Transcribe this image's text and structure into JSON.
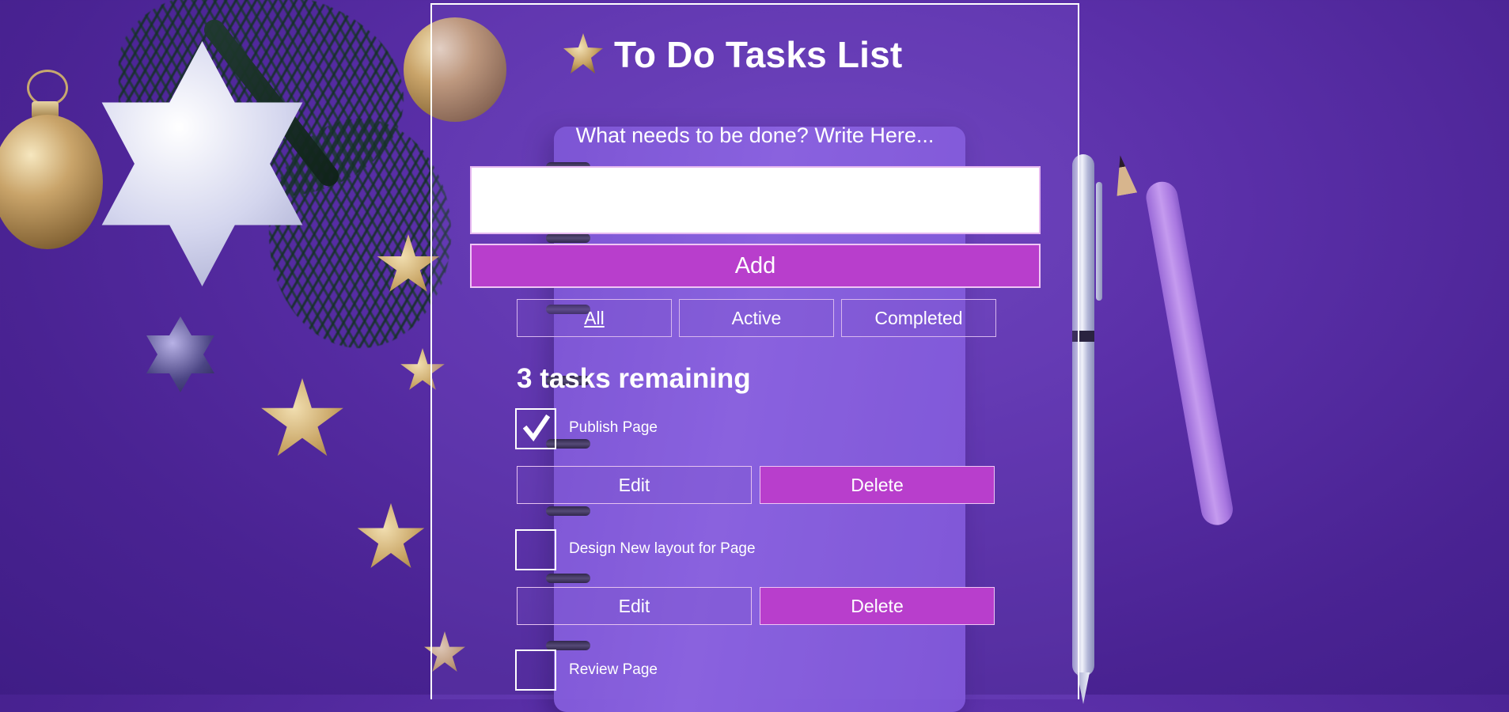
{
  "app": {
    "title": "To Do Tasks List",
    "input_prompt": "What needs to be done? Write Here...",
    "input_value": "",
    "add_label": "Add"
  },
  "filters": [
    {
      "label": "All",
      "current": true
    },
    {
      "label": "Active",
      "current": false
    },
    {
      "label": "Completed",
      "current": false
    }
  ],
  "remaining_text": "3 tasks remaining",
  "tasks": [
    {
      "name": "Publish Page",
      "completed": true,
      "edit_label": "Edit",
      "delete_label": "Delete"
    },
    {
      "name": "Design New layout for Page",
      "completed": false,
      "edit_label": "Edit",
      "delete_label": "Delete"
    },
    {
      "name": "Review Page",
      "completed": false
    }
  ],
  "colors": {
    "accent": "#b83ecc",
    "background": "#4a2393",
    "text": "#ffffff"
  },
  "icons": {
    "title_decoration": "star-icon",
    "checked": "checkmark-icon"
  }
}
